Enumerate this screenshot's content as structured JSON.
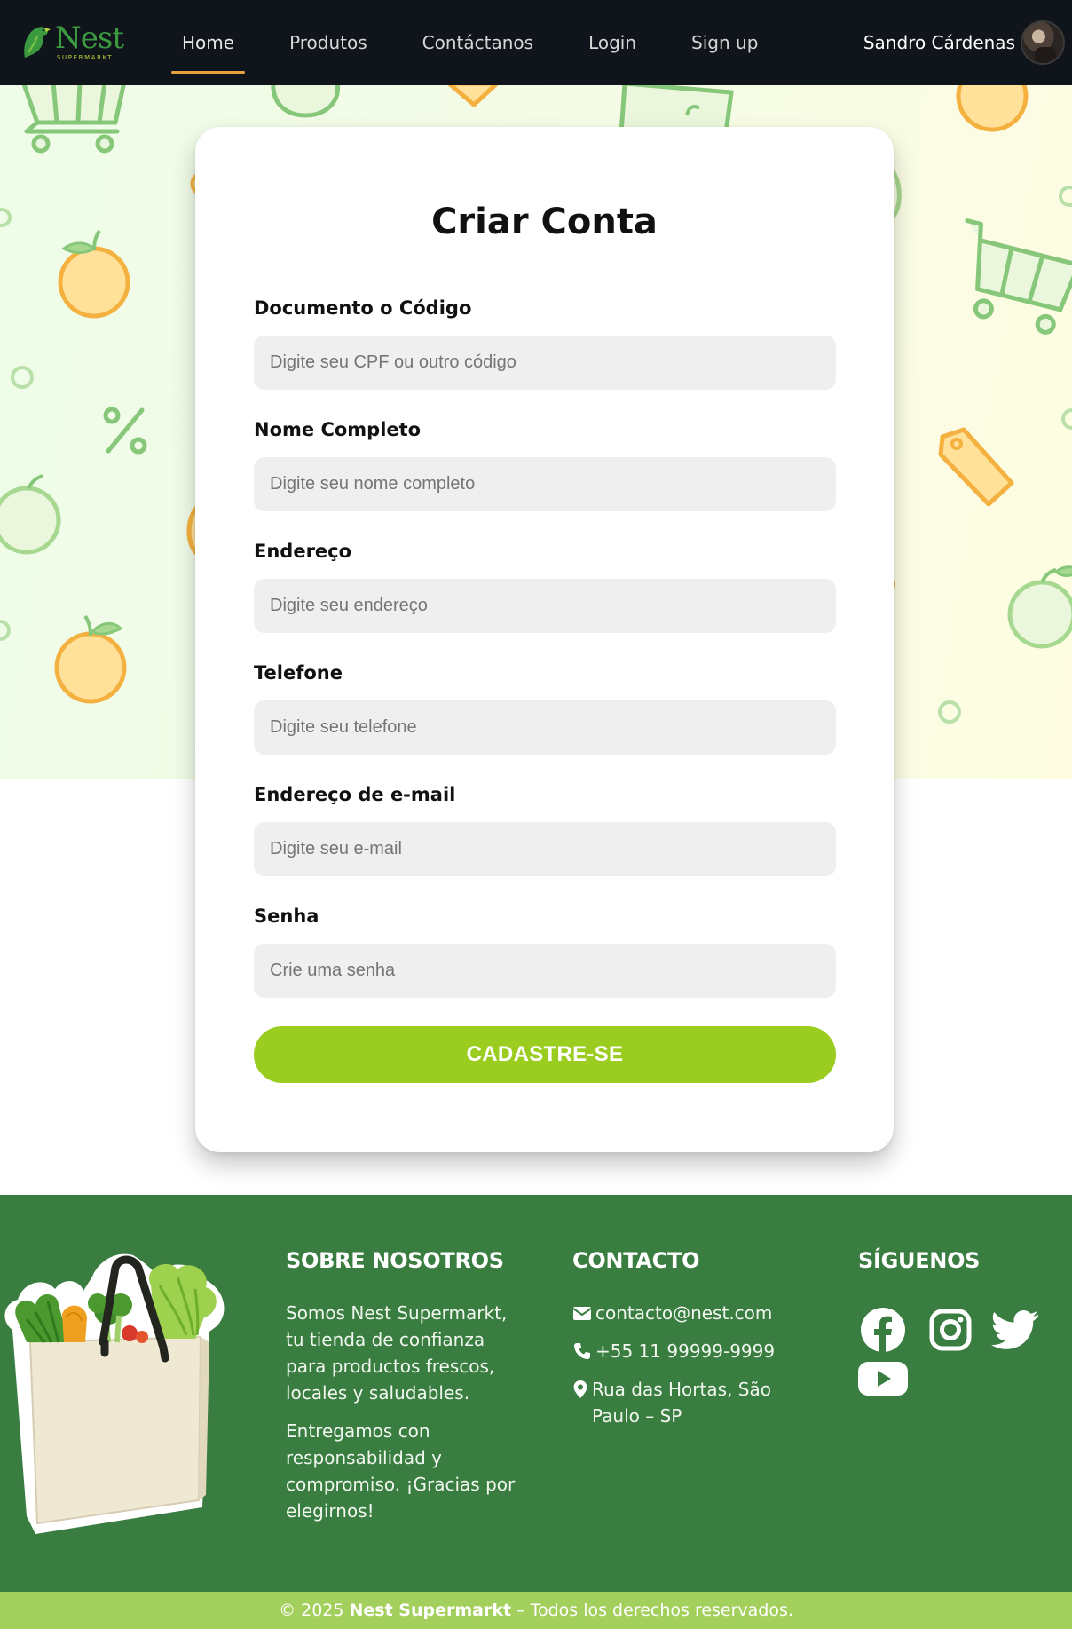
{
  "brand": {
    "name": "Nest",
    "tagline": "SUPERMARKT"
  },
  "nav": {
    "links": [
      "Home",
      "Produtos",
      "Contáctanos",
      "Login",
      "Sign up"
    ],
    "active": "Home"
  },
  "user": {
    "name": "Sandro Cárdenas"
  },
  "form": {
    "title": "Criar Conta",
    "fields": [
      {
        "label": "Documento o Código",
        "placeholder": "Digite seu CPF ou outro código",
        "value": ""
      },
      {
        "label": "Nome Completo",
        "placeholder": "Digite seu nome completo",
        "value": ""
      },
      {
        "label": "Endereço",
        "placeholder": "Digite seu endereço",
        "value": ""
      },
      {
        "label": "Telefone",
        "placeholder": "Digite seu telefone",
        "value": ""
      },
      {
        "label": "Endereço de e-mail",
        "placeholder": "Digite seu e-mail",
        "value": ""
      },
      {
        "label": "Senha",
        "placeholder": "Crie uma senha",
        "value": ""
      }
    ],
    "submit_label": "CADASTRE-SE"
  },
  "footer": {
    "about": {
      "heading": "SOBRE NOSOTROS",
      "paragraphs": [
        "Somos Nest Supermarkt, tu tienda de confianza para productos frescos, locales y saludables.",
        "Entregamos con responsabilidad y compromiso. ¡Gracias por elegirnos!"
      ]
    },
    "contact": {
      "heading": "CONTACTO",
      "email": "contacto@nest.com",
      "phone": "+55 11 99999-9999",
      "address": "Rua das Hortas, São Paulo – SP"
    },
    "social": {
      "heading": "SÍGUENOS",
      "icons": [
        "facebook-icon",
        "instagram-icon",
        "twitter-icon",
        "youtube-icon"
      ]
    },
    "copyright": {
      "prefix": "© 2025",
      "brand": "Nest Supermarkt",
      "suffix": "– Todos los derechos reservados."
    }
  },
  "colors": {
    "navbar_bg": "#10141b",
    "nav_active_underline": "#e8a13a",
    "submit_bg": "#9bcd21",
    "footer_bg": "#397d40",
    "copyright_bg": "#a3cf5c",
    "brand_green": "#3b9a3f"
  }
}
